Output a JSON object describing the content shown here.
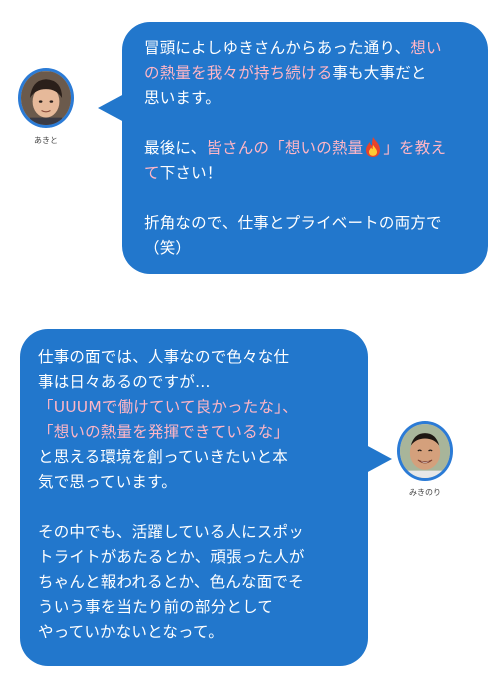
{
  "speaker1": {
    "name": "あきと",
    "message": [
      [
        {
          "t": "冒頭によしゆきさんからあった通り、"
        },
        {
          "t": "想い",
          "hl": true
        }
      ],
      [
        {
          "t": "の熱量を我々が持ち続ける",
          "hl": true
        },
        {
          "t": "事も大事だと"
        }
      ],
      [
        {
          "t": "思います。"
        }
      ],
      [],
      [
        {
          "t": "最後に、"
        },
        {
          "t": "皆さんの「想いの熱量",
          "hl": true
        },
        {
          "icon": "fire"
        },
        {
          "t": "」を教え",
          "hl": true
        }
      ],
      [
        {
          "t": "て",
          "hl": true
        },
        {
          "t": "下さい！"
        }
      ],
      [],
      [
        {
          "t": "折角なので、仕事とプライベートの両方で"
        }
      ],
      [
        {
          "t": "（笑）"
        }
      ]
    ]
  },
  "speaker2": {
    "name": "みきのり",
    "message": [
      [
        {
          "t": "仕事の面では、人事なので色々な仕"
        }
      ],
      [
        {
          "t": "事は日々あるのですが…"
        }
      ],
      [
        {
          "t": "「UUUMで働けていて良かったな」、",
          "hl": true
        }
      ],
      [
        {
          "t": "「想いの熱量を発揮できているな」",
          "hl": true
        }
      ],
      [
        {
          "t": "と思える環境を創っていきたいと本"
        }
      ],
      [
        {
          "t": "気で思っています。"
        }
      ],
      [],
      [
        {
          "t": "その中でも、活躍している人にスポッ"
        }
      ],
      [
        {
          "t": "トライトがあたるとか、頑張った人が"
        }
      ],
      [
        {
          "t": "ちゃんと報われるとか、色んな面でそ"
        }
      ],
      [
        {
          "t": "ういう事を当たり前の部分として"
        }
      ],
      [
        {
          "t": "やっていかないとなって。"
        }
      ]
    ]
  },
  "colors": {
    "bubble": "#2277cc",
    "highlight": "#ffb6c6",
    "avatar_border": "#2b7bd6"
  },
  "icons": {
    "fire": "fire-emoji-icon"
  }
}
